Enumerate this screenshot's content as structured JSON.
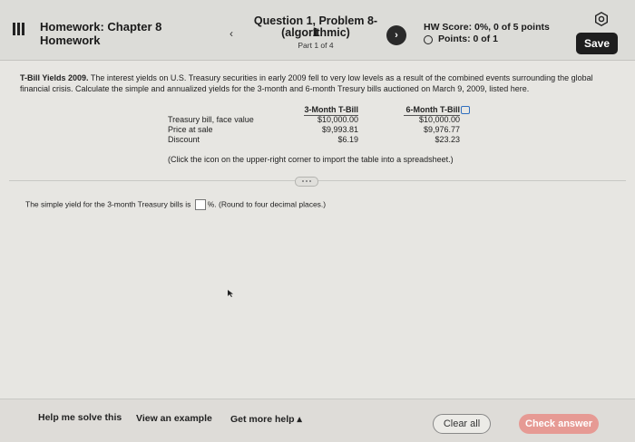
{
  "header": {
    "hw_title": "Homework: Chapter 8",
    "hw_sub": "Homework",
    "question_title": "Question 1, Problem 8-1",
    "question_algo": "(algorithmic)",
    "question_part": "Part 1 of 4",
    "prev_symbol": "‹",
    "next_symbol": "›",
    "hw_score": "HW Score: 0%, 0 of 5 points",
    "points": "Points: 0 of 1",
    "save_label": "Save"
  },
  "problem": {
    "title": "T-Bill Yields 2009.",
    "text": " The interest yields on U.S. Treasury securities in early 2009 fell to very low levels as a result of the combined events surrounding the global financial crisis. Calculate the simple and annualized yields for the 3-month and 6-month Tresury bills auctioned on March 9, 2009, listed here."
  },
  "table": {
    "headers": [
      "3-Month T-Bill",
      "6-Month T-Bill"
    ],
    "rows": [
      {
        "label": "Treasury bill, face value",
        "c1": "$10,000.00",
        "c2": "$10,000.00"
      },
      {
        "label": "Price at sale",
        "c1": "$9,993.81",
        "c2": "$9,976.77"
      },
      {
        "label": "Discount",
        "c1": "$6.19",
        "c2": "$23.23"
      }
    ],
    "note": "(Click the icon on the upper-right corner to import the table into a spreadsheet.)"
  },
  "answer": {
    "prefix": "The simple yield for the 3-month Treasury bills is",
    "suffix": "%. (Round to four decimal places.)"
  },
  "footer": {
    "help": "Help me solve this",
    "example": "View an example",
    "more": "Get more help ▴",
    "clear": "Clear all",
    "check": "Check answer"
  }
}
